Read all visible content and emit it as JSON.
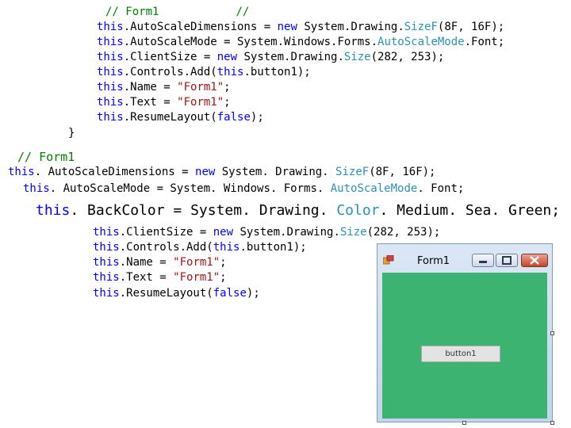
{
  "code_top": {
    "comment_line": {
      "slashes1": "// ",
      "name": "Form1",
      "slashes2": "//"
    },
    "dims": {
      "this": "this",
      "prop": ".AutoScaleDimensions = ",
      "new": "new",
      "ns": " System.Drawing.",
      "type": "SizeF",
      "args": "(8F, 16F);"
    },
    "mode": {
      "this": "this",
      "prop": ".AutoScaleMode = System.Windows.Forms.",
      "type": "AutoScaleMode",
      "rest": ".Font;"
    },
    "client": {
      "this": "this",
      "prop": ".ClientSize = ",
      "new": "new",
      "ns": " System.Drawing.",
      "type": "Size",
      "args": "(282, 253);"
    },
    "controls": {
      "this": "this",
      "prop": ".Controls.Add(",
      "this2": "this",
      "rest": ".button1);"
    },
    "name": {
      "this": "this",
      "prop": ".Name = ",
      "val": "\"Form1\"",
      "end": ";"
    },
    "text": {
      "this": "this",
      "prop": ".Text = ",
      "val": "\"Form1\"",
      "end": ";"
    },
    "resume": {
      "this": "this",
      "prop": ".ResumeLayout(",
      "kw": "false",
      "end": ");"
    },
    "brace": "}"
  },
  "code_mid": {
    "comment": "// Form1",
    "dims": {
      "this": "this",
      "prop": ". AutoScaleDimensions = ",
      "new": "new",
      "ns": " System. Drawing. ",
      "type": "SizeF",
      "args": "(8F, 16F);"
    },
    "mode": {
      "this": "this",
      "prop": ". AutoScaleMode = System. Windows. Forms. ",
      "type": "AutoScaleMode",
      "rest": ". Font;"
    },
    "backcolor": {
      "this": "this",
      "prop": ". BackColor = System. Drawing. ",
      "type": "Color",
      "rest": ". Medium. Sea. Green;"
    }
  },
  "code_bottom": {
    "client": {
      "this": "this",
      "prop": ".ClientSize = ",
      "new": "new",
      "ns": " System.Drawing.",
      "type": "Size",
      "args": "(282, 253);"
    },
    "controls": {
      "this": "this",
      "prop": ".Controls.Add(",
      "this2": "this",
      "rest": ".button1);"
    },
    "name": {
      "this": "this",
      "prop": ".Name = ",
      "val": "\"Form1\"",
      "end": ";"
    },
    "text": {
      "this": "this",
      "prop": ".Text = ",
      "val": "\"Form1\"",
      "end": ";"
    },
    "resume": {
      "this": "this",
      "prop": ".ResumeLayout(",
      "kw": "false",
      "end": ");"
    }
  },
  "form_window": {
    "title": "Form1",
    "button_label": "button1",
    "back_color": "#3cb371",
    "icons": [
      "app-icon",
      "minimize-icon",
      "maximize-icon",
      "close-icon"
    ]
  }
}
